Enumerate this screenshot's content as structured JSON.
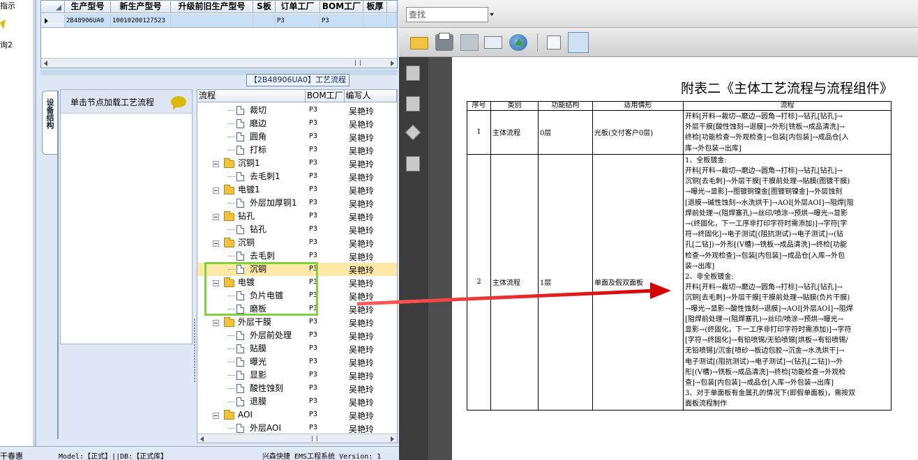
{
  "nav": {
    "top_label": "指示",
    "item_label": "询2"
  },
  "grid": {
    "columns": [
      "生产型号",
      "新生产型号",
      "升级前旧生产型号",
      "S板",
      "订单工厂",
      "BOM工厂",
      "板厚"
    ],
    "row": {
      "prod_model": "2B48906UA0",
      "new_model": "10010200127523",
      "old_model": "",
      "s_board": "",
      "order_factory": "P3",
      "bom_factory": "P3",
      "thickness": ""
    }
  },
  "process_panel": {
    "title": "【2B48906UA0】工艺流程",
    "side_tab": "设备结构",
    "hint": "单击节点加载工艺流程"
  },
  "tree": {
    "columns": [
      "流程",
      "BOM工厂",
      "编写人"
    ],
    "rows": [
      {
        "name": "裁切",
        "level": 2,
        "type": "step",
        "factory": "P3",
        "author": "吴艳玲"
      },
      {
        "name": "磨边",
        "level": 2,
        "type": "step",
        "factory": "P3",
        "author": "吴艳玲"
      },
      {
        "name": "圆角",
        "level": 2,
        "type": "step",
        "factory": "P3",
        "author": "吴艳玲"
      },
      {
        "name": "打标",
        "level": 2,
        "type": "step",
        "factory": "P3",
        "author": "吴艳玲"
      },
      {
        "name": "沉铜1",
        "level": 1,
        "type": "group",
        "factory": "P3",
        "author": "吴艳玲"
      },
      {
        "name": "去毛刺1",
        "level": 2,
        "type": "step",
        "factory": "P3",
        "author": "吴艳玲"
      },
      {
        "name": "电镀1",
        "level": 1,
        "type": "group",
        "factory": "P3",
        "author": "吴艳玲"
      },
      {
        "name": "外层加厚铜1",
        "level": 2,
        "type": "step",
        "factory": "P3",
        "author": "吴艳玲"
      },
      {
        "name": "钻孔",
        "level": 1,
        "type": "group",
        "factory": "P3",
        "author": "吴艳玲"
      },
      {
        "name": "钻孔",
        "level": 2,
        "type": "step",
        "factory": "P3",
        "author": "吴艳玲"
      },
      {
        "name": "沉铜",
        "level": 1,
        "type": "group",
        "factory": "P3",
        "author": "吴艳玲"
      },
      {
        "name": "去毛刺",
        "level": 2,
        "type": "step",
        "factory": "P3",
        "author": "吴艳玲"
      },
      {
        "name": "沉铜",
        "level": 2,
        "type": "step",
        "factory": "P3",
        "author": "吴艳玲",
        "selected": true
      },
      {
        "name": "电镀",
        "level": 1,
        "type": "group",
        "factory": "P3",
        "author": "吴艳玲"
      },
      {
        "name": "负片电镀",
        "level": 2,
        "type": "step",
        "factory": "P3",
        "author": "吴艳玲"
      },
      {
        "name": "磨板",
        "level": 2,
        "type": "step",
        "factory": "P3",
        "author": "吴艳玲"
      },
      {
        "name": "外层干膜",
        "level": 1,
        "type": "group",
        "factory": "P3",
        "author": "吴艳玲"
      },
      {
        "name": "外层前处理",
        "level": 2,
        "type": "step",
        "factory": "P3",
        "author": "吴艳玲"
      },
      {
        "name": "贴膜",
        "level": 2,
        "type": "step",
        "factory": "P3",
        "author": "吴艳玲"
      },
      {
        "name": "曝光",
        "level": 2,
        "type": "step",
        "factory": "P3",
        "author": "吴艳玲"
      },
      {
        "name": "显影",
        "level": 2,
        "type": "step",
        "factory": "P3",
        "author": "吴艳玲"
      },
      {
        "name": "酸性蚀刻",
        "level": 2,
        "type": "step",
        "factory": "P3",
        "author": "吴艳玲"
      },
      {
        "name": "退膜",
        "level": 2,
        "type": "step",
        "factory": "P3",
        "author": "吴艳玲"
      },
      {
        "name": "AOI",
        "level": 1,
        "type": "group",
        "factory": "P3",
        "author": "吴艳玲"
      },
      {
        "name": "外层AOI",
        "level": 2,
        "type": "step",
        "factory": "P3",
        "author": "吴艳玲"
      }
    ]
  },
  "status_bar": {
    "user": "干春惠",
    "model_info": "Model:【正式】||DB:【正式库】",
    "app_info": "兴森快捷 EMS工程系统 Version: 1"
  },
  "pdf": {
    "search_placeholder": "查找",
    "title": "附表二《主体工艺流程与流程组件》",
    "columns": [
      "序号",
      "类别",
      "功能结构",
      "适用情形",
      "流程"
    ],
    "rows": [
      {
        "no": "1",
        "category": "主体流程",
        "structure": "0层",
        "case": "光板(交付客户0层)",
        "flow": [
          "开料[开料→裁切→磨边→圆角→打标]→钻孔[钻孔]→",
          "外层干膜[酸性蚀刻→退膜]→外形[铣板→成品清洗]→",
          "终检[功能检查→外观检查]→包装[内包装]→成品仓[入",
          "库→外包装→出库]"
        ]
      },
      {
        "no": "2",
        "category": "主体流程",
        "structure": "1层",
        "case": "单面及假双面板",
        "flow": [
          "1、全板镀金:",
          "开料[开料→裁切→磨边→圆角→打标]→钻孔[钻孔]→",
          "沉铜[去毛刺]→外层干膜[干膜前处理→贴膜(图镀干膜)",
          "→曝光→显影]→图镀铜镍金[图镀铜镍金]→外层蚀刻",
          "[退膜→碱性蚀刻→水洗烘干]→AOI[外层AOI]→阻焊[阻",
          "焊前处理→(阻焊塞孔)→丝印/喷涂→预烘→曝光→显影",
          "→(终固化，下一工序非打印字符时需添加)]→字符[字",
          "符→终固化]→电子测试[(阻抗测试)→电子测试]→(钻",
          "孔[二钻])→外形[(V槽)→铣板→成品清洗]→终检[功能",
          "检查→外观检查]→包装[内包装]→成品仓[入库→外包",
          "装→出库]",
          "2、非全板镀金:",
          "开料[开料→裁切→磨边→圆角→打标]→钻孔[钻孔]→",
          "沉铜[去毛刺]→外层干膜[干膜前处理→贴膜(负片干膜)",
          "→曝光→显影→酸性蚀刻→退膜]→AOI[外层AOI]→阻焊",
          "[阻焊前处理→(阻焊塞孔)→丝印/喷涂→预烘→曝光→",
          "显影→(终固化，下一工序非打印字符时需添加)]→字符",
          "[字符→终固化]→有铅喷锡/无铅喷锡[烘板→有铅喷锡/",
          "无铅喷锡]/沉金[喷砂→板边包胶→沉金→水洗烘干]→",
          "电子测试[(阻抗测试)→电子测试]→(钻孔[二钻])→外",
          "形[(V槽)→铣板→成品清洗]→终检[功能检查→外观检",
          "查]→包装[内包装]→成品仓[入库→外包装→出库]",
          "3、对于单面板有金属孔的情况下(即假单面板)，需按双",
          "面板流程制作"
        ]
      }
    ]
  },
  "colors": {
    "highlight": "#7fd23c",
    "arrow": "#e01010",
    "selected_row": "#ffe9a8"
  }
}
